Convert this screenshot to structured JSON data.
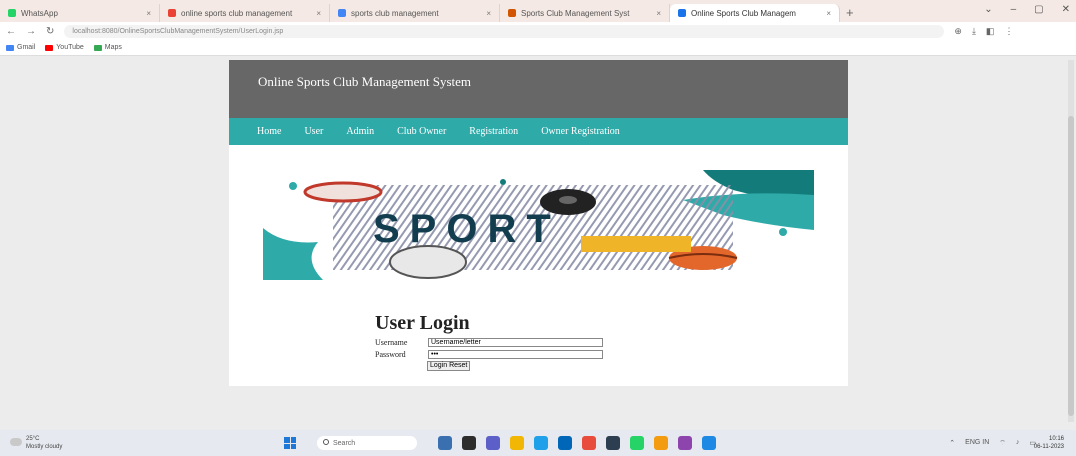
{
  "browser": {
    "tabs": [
      {
        "label": "WhatsApp",
        "color": "#25d366"
      },
      {
        "label": "online sports club management",
        "color": "#ea4335"
      },
      {
        "label": "sports club management",
        "color": "#4285f4"
      },
      {
        "label": "Sports Club Management Syst",
        "color": "#d35400"
      },
      {
        "label": "Online Sports Club Managem",
        "color": "#1a73e8"
      }
    ],
    "new_tab": "+",
    "url": "localhost:8080/OnlineSportsClubManagementSystem/UserLogin.jsp",
    "bookmarks": [
      {
        "label": "Gmail",
        "color": "#4285f4"
      },
      {
        "label": "YouTube",
        "color": "#ff0000"
      },
      {
        "label": "Maps",
        "color": "#34a853"
      }
    ]
  },
  "site": {
    "title": "Online Sports Club Management System",
    "nav": [
      "Home",
      "User",
      "Admin",
      "Club Owner",
      "Registration",
      "Owner Registration"
    ]
  },
  "login": {
    "heading": "User Login",
    "username_label": "Username",
    "username_value": "Username/letter",
    "password_label": "Password",
    "password_value": "•••",
    "button": "Login Reset"
  },
  "taskbar": {
    "weather_temp": "25°C",
    "weather_desc": "Mostly cloudy",
    "search_placeholder": "Search",
    "lang": "ENG IN",
    "time": "10:16",
    "date": "06-11-2023"
  }
}
